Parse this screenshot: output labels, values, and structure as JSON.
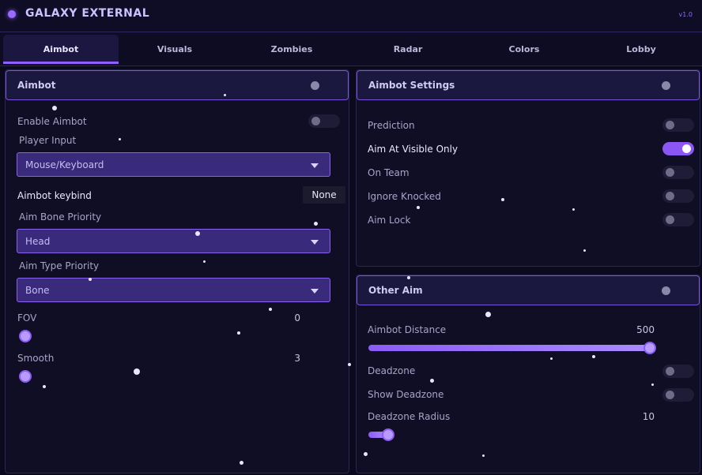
{
  "app": {
    "title": "GALAXY EXTERNAL",
    "version": "v1.0"
  },
  "tabs": [
    {
      "label": "Aimbot",
      "active": true
    },
    {
      "label": "Visuals",
      "active": false
    },
    {
      "label": "Zombies",
      "active": false
    },
    {
      "label": "Radar",
      "active": false
    },
    {
      "label": "Colors",
      "active": false
    },
    {
      "label": "Lobby",
      "active": false
    }
  ],
  "aimbot": {
    "title": "Aimbot",
    "enable_label": "Enable Aimbot",
    "enable_on": false,
    "player_input_label": "Player Input",
    "player_input_value": "Mouse/Keyboard",
    "keybind_label": "Aimbot keybind",
    "keybind_value": "None",
    "bone_priority_label": "Aim Bone Priority",
    "bone_priority_value": "Head",
    "type_priority_label": "Aim Type Priority",
    "type_priority_value": "Bone",
    "fov_label": "FOV",
    "fov_value": "0",
    "fov_fraction": 0.0,
    "smooth_label": "Smooth",
    "smooth_value": "3",
    "smooth_fraction": 0.02
  },
  "aimbot_settings": {
    "title": "Aimbot Settings",
    "rows": [
      {
        "label": "Prediction",
        "on": false,
        "bright": false
      },
      {
        "label": "Aim At Visible Only",
        "on": true,
        "bright": true
      },
      {
        "label": "On Team",
        "on": false,
        "bright": false
      },
      {
        "label": "Ignore Knocked",
        "on": false,
        "bright": false
      },
      {
        "label": "Aim Lock",
        "on": false,
        "bright": false
      }
    ]
  },
  "other_aim": {
    "title": "Other Aim",
    "distance_label": "Aimbot Distance",
    "distance_value": "500",
    "distance_fraction": 1.0,
    "deadzone_label": "Deadzone",
    "deadzone_on": false,
    "show_deadzone_label": "Show Deadzone",
    "show_deadzone_on": false,
    "radius_label": "Deadzone Radius",
    "radius_value": "10",
    "radius_fraction": 0.07
  },
  "colors": {
    "accent": "#8b5cf6",
    "background": "#0b0a1c",
    "panel": "#0f0e24"
  }
}
